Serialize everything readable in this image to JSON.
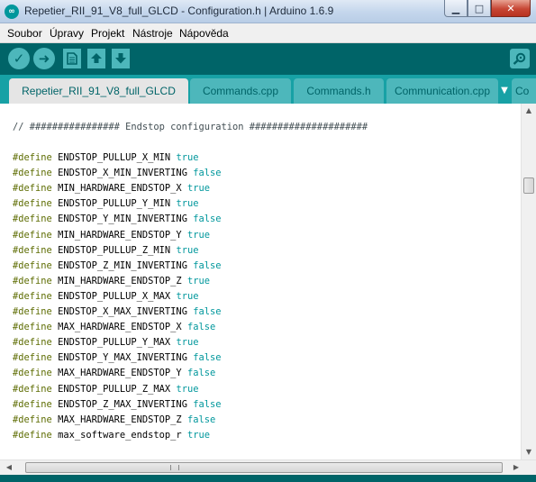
{
  "window": {
    "title": "Repetier_RII_91_V8_full_GLCD - Configuration.h | Arduino 1.6.9",
    "app_icon": "arduino-logo-icon",
    "controls": {
      "minimize": "▁",
      "maximize": "□",
      "close": "✕"
    }
  },
  "menu": [
    "Soubor",
    "Úpravy",
    "Projekt",
    "Nástroje",
    "Nápověda"
  ],
  "toolbar": {
    "verify_icon": "checkmark-icon",
    "upload_icon": "right-arrow-icon",
    "new_icon": "new-file-icon",
    "open_icon": "up-arrow-icon",
    "save_icon": "down-arrow-icon",
    "serial_icon": "magnifier-icon",
    "verify_glyph": "✓",
    "upload_glyph": "➜"
  },
  "tabs": [
    {
      "label": "Repetier_RII_91_V8_full_GLCD",
      "active": true
    },
    {
      "label": "Commands.cpp",
      "active": false
    },
    {
      "label": "Commands.h",
      "active": false
    },
    {
      "label": "Communication.cpp",
      "active": false
    },
    {
      "label": "Co",
      "active": false
    }
  ],
  "tab_menu_glyph": "▼",
  "editor": {
    "comment": "// ################ Endstop configuration #####################",
    "define_keyword": "#define",
    "defines": [
      {
        "name": "ENDSTOP_PULLUP_X_MIN",
        "value": "true"
      },
      {
        "name": "ENDSTOP_X_MIN_INVERTING",
        "value": "false"
      },
      {
        "name": "MIN_HARDWARE_ENDSTOP_X",
        "value": "true"
      },
      {
        "name": "ENDSTOP_PULLUP_Y_MIN",
        "value": "true"
      },
      {
        "name": "ENDSTOP_Y_MIN_INVERTING",
        "value": "false"
      },
      {
        "name": "MIN_HARDWARE_ENDSTOP_Y",
        "value": "true"
      },
      {
        "name": "ENDSTOP_PULLUP_Z_MIN",
        "value": "true"
      },
      {
        "name": "ENDSTOP_Z_MIN_INVERTING",
        "value": "false"
      },
      {
        "name": "MIN_HARDWARE_ENDSTOP_Z",
        "value": "true"
      },
      {
        "name": "ENDSTOP_PULLUP_X_MAX",
        "value": "true"
      },
      {
        "name": "ENDSTOP_X_MAX_INVERTING",
        "value": "false"
      },
      {
        "name": "MAX_HARDWARE_ENDSTOP_X",
        "value": "false"
      },
      {
        "name": "ENDSTOP_PULLUP_Y_MAX",
        "value": "true"
      },
      {
        "name": "ENDSTOP_Y_MAX_INVERTING",
        "value": "false"
      },
      {
        "name": "MAX_HARDWARE_ENDSTOP_Y",
        "value": "false"
      },
      {
        "name": "ENDSTOP_PULLUP_Z_MAX",
        "value": "true"
      },
      {
        "name": "ENDSTOP_Z_MAX_INVERTING",
        "value": "false"
      },
      {
        "name": "MAX_HARDWARE_ENDSTOP_Z",
        "value": "false"
      },
      {
        "name": "max_software_endstop_r",
        "value": "true"
      }
    ]
  },
  "scrollbars": {
    "up_glyph": "▲",
    "down_glyph": "▼",
    "left_glyph": "◀",
    "right_glyph": "▶"
  },
  "colors": {
    "toolbar": "#006468",
    "tabbar": "#17a1a5",
    "button": "#4db7bb",
    "active_tab": "#e5e5e5",
    "define_keyword": "#5e6d03",
    "literal": "#00979c"
  }
}
